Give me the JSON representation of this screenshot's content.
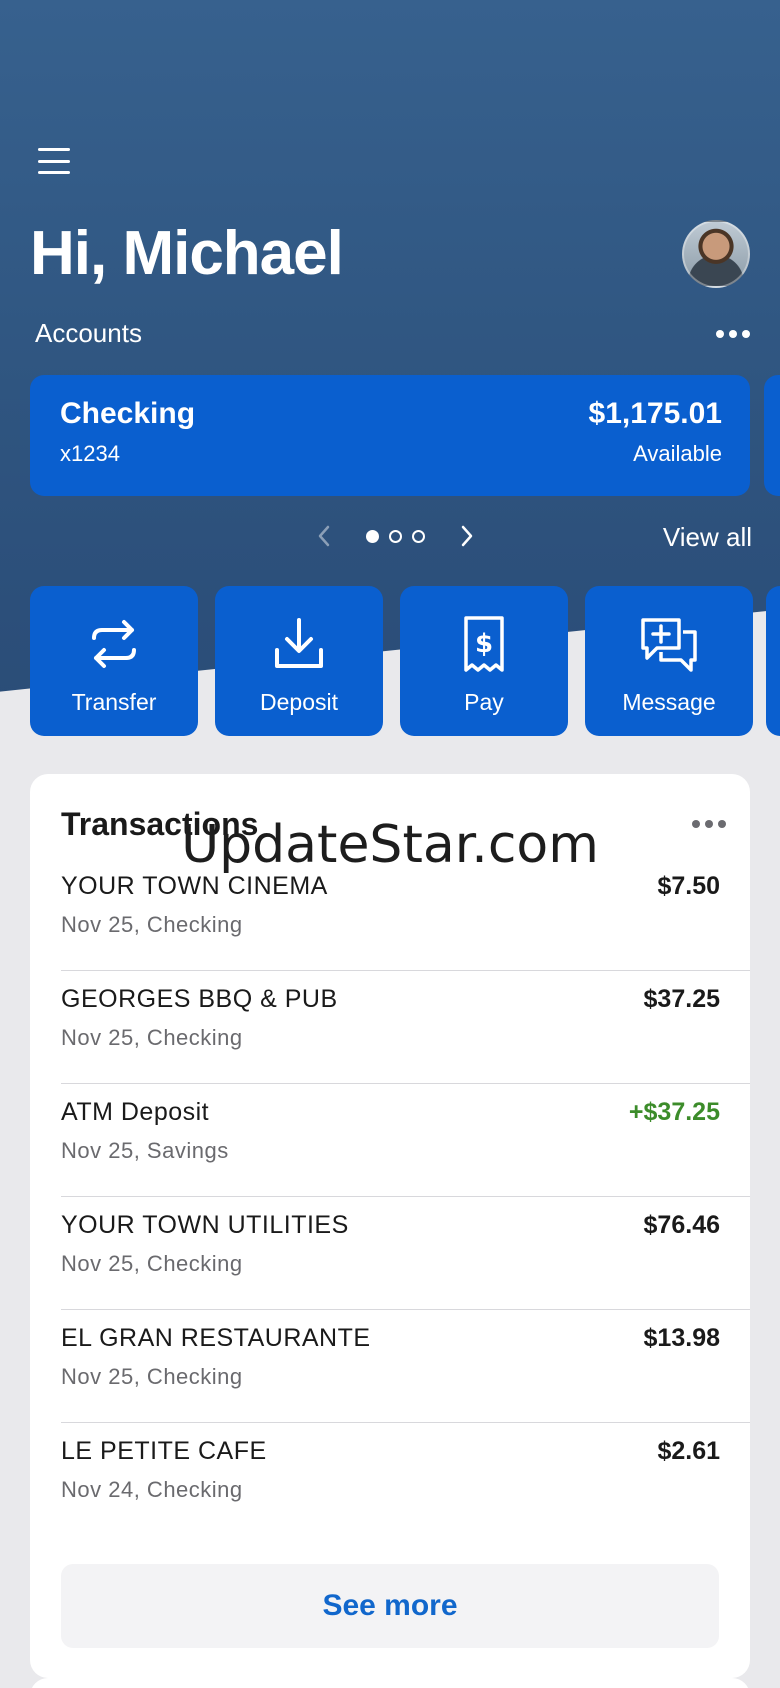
{
  "header": {
    "greeting": "Hi, Michael",
    "accounts_label": "Accounts"
  },
  "account_card": {
    "name": "Checking",
    "number": "x1234",
    "balance": "$1,175.01",
    "balance_label": "Available"
  },
  "pager": {
    "total_pages": 3,
    "current_page": 1,
    "view_all_label": "View all"
  },
  "actions": [
    {
      "label": "Transfer",
      "icon": "transfer-icon"
    },
    {
      "label": "Deposit",
      "icon": "deposit-icon"
    },
    {
      "label": "Pay",
      "icon": "bill-pay-icon"
    },
    {
      "label": "Message",
      "icon": "message-icon"
    }
  ],
  "transactions": {
    "title": "Transactions",
    "items": [
      {
        "merchant": "YOUR TOWN CINEMA",
        "detail": "Nov 25, Checking",
        "amount": "$7.50",
        "type": "debit"
      },
      {
        "merchant": "GEORGES BBQ & PUB",
        "detail": "Nov 25, Checking",
        "amount": "$37.25",
        "type": "debit"
      },
      {
        "merchant": "ATM Deposit",
        "detail": "Nov 25, Savings",
        "amount": "+$37.25",
        "type": "credit"
      },
      {
        "merchant": "YOUR TOWN UTILITIES",
        "detail": "Nov 25, Checking",
        "amount": "$76.46",
        "type": "debit"
      },
      {
        "merchant": "EL GRAN RESTAURANTE",
        "detail": "Nov 25, Checking",
        "amount": "$13.98",
        "type": "debit"
      },
      {
        "merchant": "LE PETITE CAFE",
        "detail": "Nov 24, Checking",
        "amount": "$2.61",
        "type": "debit"
      }
    ],
    "see_more_label": "See more"
  },
  "watermark": "UpdateStar.com",
  "colors": {
    "brand_blue": "#0a5fcf",
    "header_bg": "#2f5580",
    "credit_green": "#3c8c2a",
    "link_blue": "#1167cc"
  }
}
